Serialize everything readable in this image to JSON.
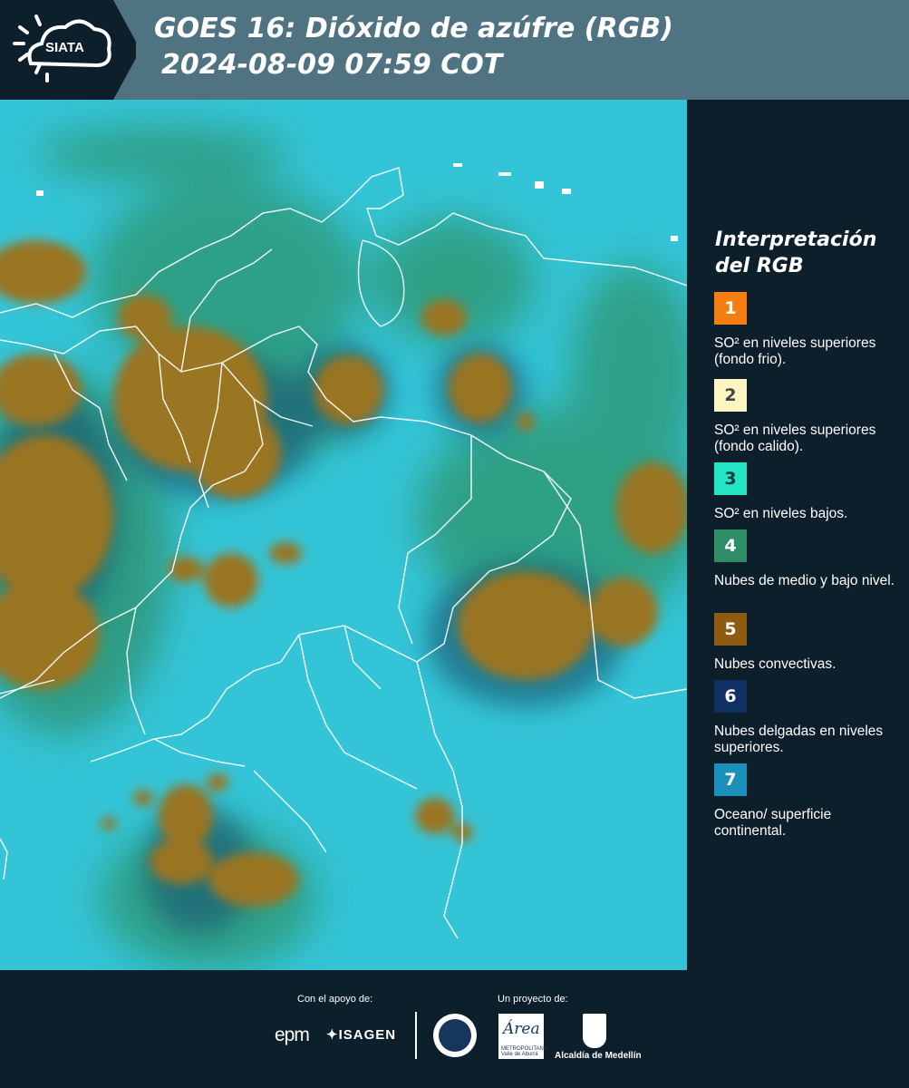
{
  "header": {
    "logo_text": "SIATA",
    "title": "GOES 16: Dióxido de azúfre (RGB)",
    "subtitle": "2024-08-09 07:59 COT"
  },
  "legend": {
    "title": "Interpretación del RGB",
    "items": [
      {
        "number": "1",
        "color": "#f47f10",
        "text_color": "#ffffff",
        "label": "SO² en niveles superiores (fondo frio)."
      },
      {
        "number": "2",
        "color": "#fdf5c1",
        "text_color": "#444444",
        "label": "SO² en niveles superiores (fondo calido)."
      },
      {
        "number": "3",
        "color": "#24e6c5",
        "text_color": "#0d3b3b",
        "label": "SO² en niveles bajos."
      },
      {
        "number": "4",
        "color": "#2e8c67",
        "text_color": "#ffffff",
        "label": "Nubes de medio y bajo nivel."
      },
      {
        "number": "5",
        "color": "#8f5b12",
        "text_color": "#ffffff",
        "label": "Nubes convectivas."
      },
      {
        "number": "6",
        "color": "#102f63",
        "text_color": "#ffffff",
        "label": "Nubes delgadas en niveles superiores."
      },
      {
        "number": "7",
        "color": "#1a90bb",
        "text_color": "#ffffff",
        "label": "Oceano/ superficie continental."
      }
    ]
  },
  "map": {
    "background_color": "#36c6d8",
    "convective_color": "#9a7520",
    "border_color": "#ffffff"
  },
  "footer": {
    "support_label": "Con el apoyo de:",
    "project_label": "Un proyecto de:",
    "epm_logo": "epm",
    "isagen_logo": "ISAGEN",
    "area_logo": "Área",
    "area_subtext": "METROPOLITANA Valle de Aburrá",
    "medellin_label": "Alcaldía de Medellín"
  }
}
